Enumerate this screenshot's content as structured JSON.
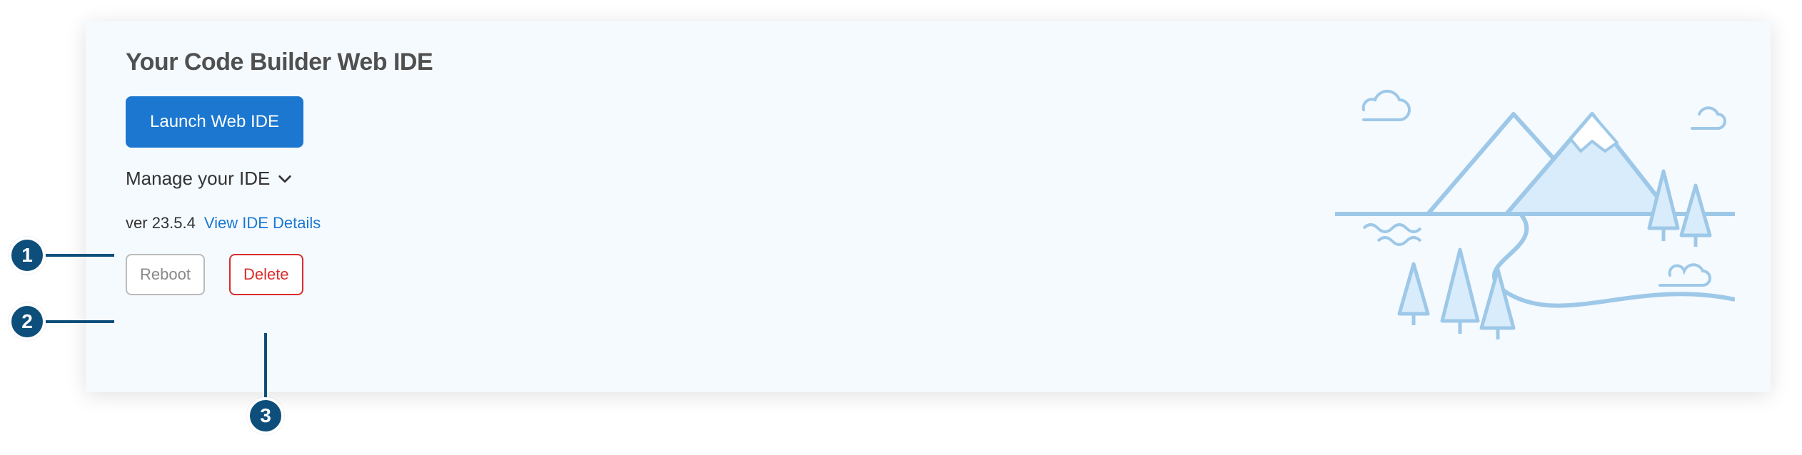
{
  "card": {
    "title": "Your Code Builder Web IDE",
    "launch_label": "Launch Web IDE",
    "manage_label": "Manage your IDE",
    "version_prefix": "ver",
    "version": "23.5.4",
    "details_link": "View IDE Details",
    "reboot_label": "Reboot",
    "delete_label": "Delete"
  },
  "callouts": {
    "one": "1",
    "two": "2",
    "three": "3"
  },
  "colors": {
    "card_bg": "#f5faff",
    "primary": "#1b77d0",
    "danger": "#d92d2d",
    "callout": "#0d4f7a"
  }
}
